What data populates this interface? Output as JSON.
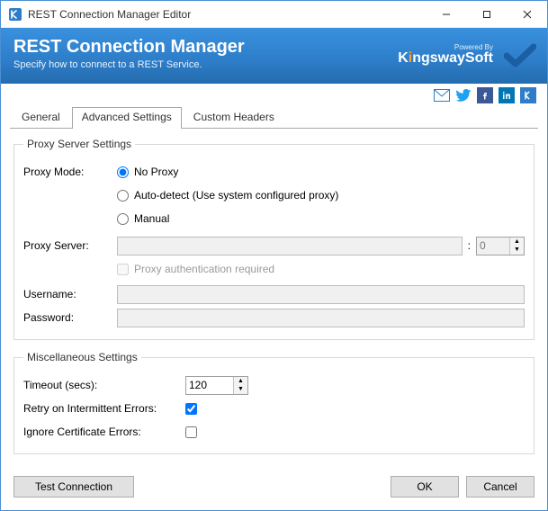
{
  "window": {
    "title": "REST Connection Manager Editor"
  },
  "header": {
    "title": "REST Connection Manager",
    "subtitle": "Specify how to connect to a REST Service.",
    "powered_by": "Powered By",
    "brand_pre": "K",
    "brand_i": "i",
    "brand_post": "ngswaySoft"
  },
  "tabs": {
    "general": "General",
    "advanced": "Advanced Settings",
    "custom": "Custom Headers"
  },
  "proxy": {
    "legend": "Proxy Server Settings",
    "mode_label": "Proxy Mode:",
    "opt_none": "No Proxy",
    "opt_auto": "Auto-detect (Use system configured proxy)",
    "opt_manual": "Manual",
    "server_label": "Proxy Server:",
    "server_value": "",
    "port_sep": ":",
    "port_value": "0",
    "auth_label": "Proxy authentication required",
    "user_label": "Username:",
    "user_value": "",
    "pass_label": "Password:",
    "pass_value": ""
  },
  "misc": {
    "legend": "Miscellaneous Settings",
    "timeout_label": "Timeout (secs):",
    "timeout_value": "120",
    "retry_label": "Retry on Intermittent Errors:",
    "ignore_label": "Ignore Certificate Errors:"
  },
  "buttons": {
    "test": "Test Connection",
    "ok": "OK",
    "cancel": "Cancel"
  }
}
